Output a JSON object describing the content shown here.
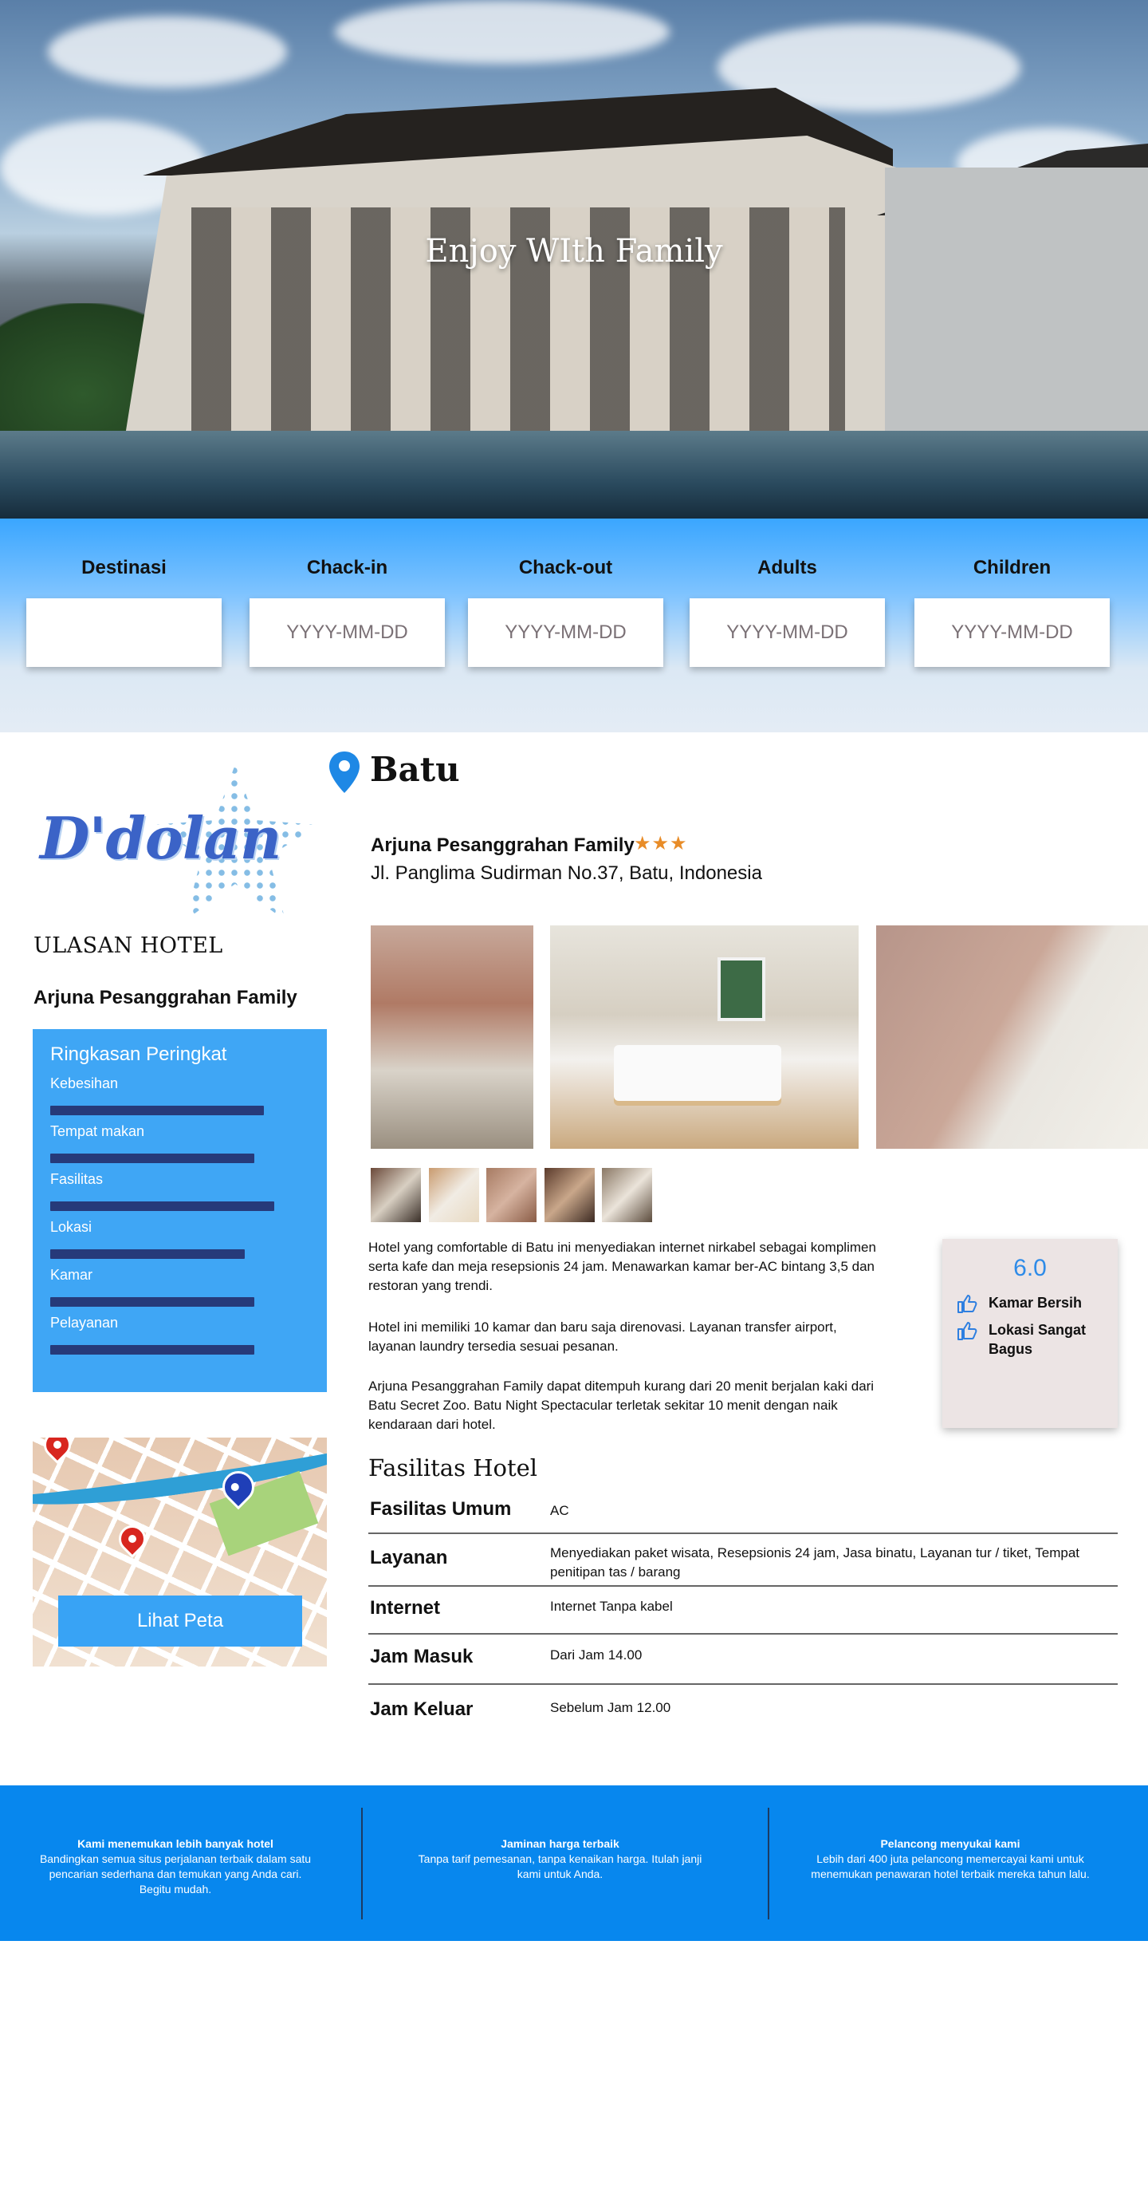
{
  "hero": {
    "title": "Enjoy WIth Family"
  },
  "search": {
    "fields": [
      {
        "label": "Destinasi",
        "placeholder": ""
      },
      {
        "label": "Chack-in",
        "placeholder": "YYYY-MM-DD"
      },
      {
        "label": "Chack-out",
        "placeholder": "YYYY-MM-DD"
      },
      {
        "label": "Adults",
        "placeholder": "YYYY-MM-DD"
      },
      {
        "label": "Children",
        "placeholder": "YYYY-MM-DD"
      }
    ]
  },
  "sidebar": {
    "logo_text": "D'dolan",
    "section_title": "ULASAN HOTEL",
    "hotel_name": "Arjuna Pesanggrahan Family",
    "rating": {
      "title": "Ringkasan Peringkat",
      "items": [
        {
          "label": "Kebesihan",
          "level": 0.88
        },
        {
          "label": "Tempat makan",
          "level": 0.84
        },
        {
          "label": "Fasilitas",
          "level": 0.92
        },
        {
          "label": "Lokasi",
          "level": 0.8
        },
        {
          "label": "Kamar",
          "level": 0.84
        },
        {
          "label": "Pelayanan",
          "level": 0.84
        }
      ],
      "bar_color": "#263a7a"
    },
    "map_button": "Lihat Peta"
  },
  "main": {
    "city": "Batu",
    "hotel_title": "Arjuna Pesanggrahan Family",
    "stars": "★★★",
    "star_rating": 3,
    "address": "Jl. Panglima Sudirman No.37, Batu, Indonesia",
    "description": [
      "Hotel yang comfortable di Batu ini menyediakan internet nirkabel sebagai komplimen serta kafe dan meja resepsionis 24 jam. Menawarkan kamar ber-AC bintang 3,5 dan restoran yang trendi.",
      "Hotel ini memiliki 10 kamar dan baru saja direnovasi. Layanan transfer airport, layanan laundry tersedia sesuai pesanan.",
      "Arjuna Pesanggrahan Family dapat ditempuh kurang dari 20 menit berjalan kaki dari Batu Secret Zoo. Batu Night Spectacular terletak sekitar 10 menit dengan naik kendaraan dari hotel."
    ],
    "score": {
      "value": "6.0",
      "pros": [
        "Kamar Bersih",
        "Lokasi Sangat Bagus"
      ]
    },
    "facilities": {
      "title": "Fasilitas Hotel",
      "rows": [
        {
          "key": "Fasilitas Umum",
          "value": "AC"
        },
        {
          "key": "Layanan",
          "value": "Menyediakan paket wisata, Resepsionis 24 jam, Jasa binatu, Layanan tur / tiket, Tempat penitipan tas / barang"
        },
        {
          "key": "Internet",
          "value": "Internet Tanpa kabel"
        },
        {
          "key": "Jam Masuk",
          "value": "Dari Jam 14.00"
        },
        {
          "key": "Jam Keluar",
          "value": "Sebelum Jam 12.00"
        }
      ]
    }
  },
  "footer": {
    "columns": [
      {
        "title": "Kami menemukan lebih banyak hotel",
        "text": "Bandingkan semua situs perjalanan terbaik dalam satu pencarian sederhana dan temukan yang Anda cari. Begitu mudah."
      },
      {
        "title": "Jaminan harga terbaik",
        "text": "Tanpa tarif pemesanan, tanpa kenaikan harga. Itulah janji kami untuk Anda."
      },
      {
        "title": "Pelancong menyukai kami",
        "text": "Lebih dari 400 juta pelancong memercayai kami untuk menemukan penawaran hotel terbaik mereka tahun lalu."
      }
    ]
  },
  "colors": {
    "accent": "#3fa6f5",
    "footer": "#0787ee",
    "star": "#e88c28",
    "score": "#2e8be8"
  }
}
